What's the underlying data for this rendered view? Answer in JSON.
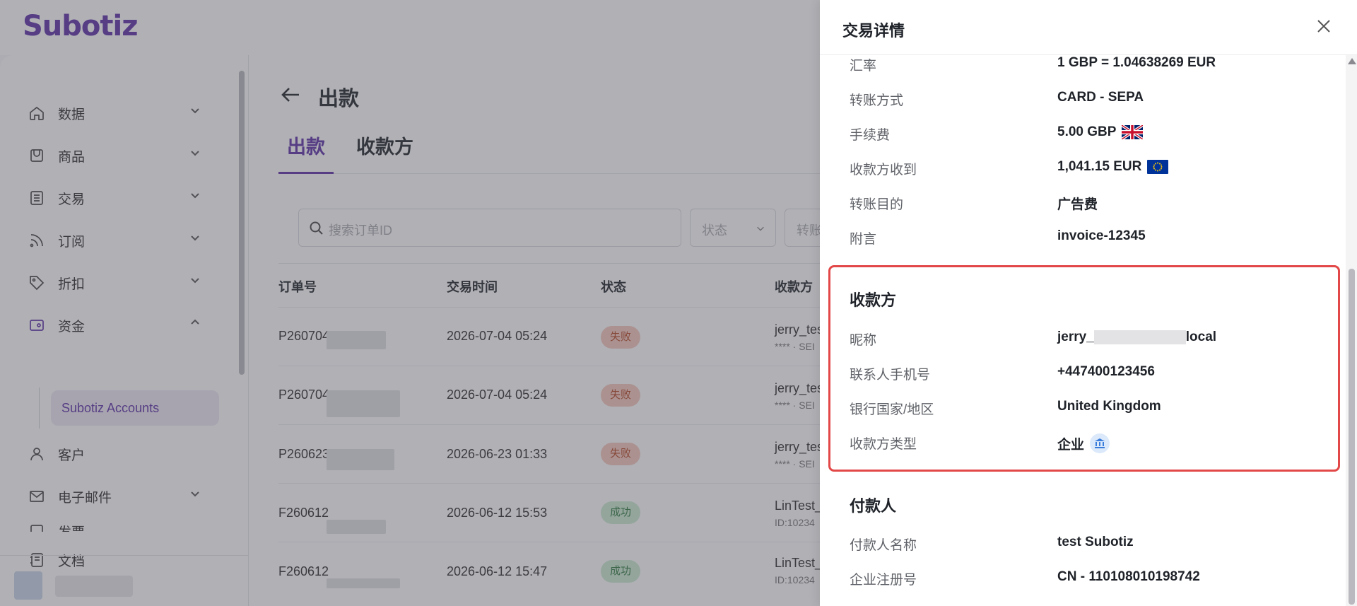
{
  "app": {
    "logo": "Subotiz"
  },
  "sidebar": {
    "items": [
      {
        "label": "数据",
        "icon": "home-icon"
      },
      {
        "label": "商品",
        "icon": "store-icon"
      },
      {
        "label": "交易",
        "icon": "list-icon"
      },
      {
        "label": "订阅",
        "icon": "rss-icon"
      },
      {
        "label": "折扣",
        "icon": "tag-icon"
      },
      {
        "label": "资金",
        "icon": "wallet-icon"
      },
      {
        "label": "客户",
        "icon": "user-icon"
      },
      {
        "label": "电子邮件",
        "icon": "mail-icon"
      },
      {
        "label": "发票",
        "icon": "invoice-icon"
      }
    ],
    "sub_item": "Subotiz Accounts",
    "docs_label": "文档"
  },
  "main": {
    "title": "出款",
    "tabs": [
      "出款",
      "收款方"
    ],
    "search_placeholder": "搜索订单ID",
    "status_placeholder": "状态",
    "third_filter": "转账",
    "columns": [
      "订单号",
      "交易时间",
      "状态",
      "收款方"
    ],
    "rows": [
      {
        "order": "P260704",
        "time": "2026-07-04 05:24",
        "status": "失败",
        "status_type": "fail",
        "payee": "jerry_tes",
        "payee_sub": "**** · SEI"
      },
      {
        "order": "P260704",
        "time": "2026-07-04 05:24",
        "status": "失败",
        "status_type": "fail",
        "payee": "jerry_tes",
        "payee_sub": "**** · SEI"
      },
      {
        "order": "P260623",
        "time": "2026-06-23 01:33",
        "status": "失败",
        "status_type": "fail",
        "payee": "jerry_tes",
        "payee_sub": "**** · SEI"
      },
      {
        "order": "F260612",
        "time": "2026-06-12 15:53",
        "status": "成功",
        "status_type": "ok",
        "payee": "LinTest_",
        "payee_sub": "ID:10234"
      },
      {
        "order": "F260612",
        "time": "2026-06-12 15:47",
        "status": "成功",
        "status_type": "ok",
        "payee": "LinTest_",
        "payee_sub": "ID:10234"
      }
    ]
  },
  "drawer": {
    "title": "交易详情",
    "details": [
      {
        "label": "汇率",
        "value": "1 GBP = 1.04638269 EUR"
      },
      {
        "label": "转账方式",
        "value": "CARD - SEPA"
      },
      {
        "label": "手续费",
        "value": "5.00 GBP",
        "flag": "uk-flag-icon"
      },
      {
        "label": "收款方收到",
        "value": "1,041.15 EUR",
        "flag": "eu-flag-icon"
      },
      {
        "label": "转账目的",
        "value": "广告费"
      },
      {
        "label": "附言",
        "value": "invoice-12345"
      }
    ],
    "payee": {
      "section_title": "收款方",
      "nickname_label": "昵称",
      "nickname_prefix": "jerry_",
      "nickname_suffix": "local",
      "phone_label": "联系人手机号",
      "phone_value": "+447400123456",
      "country_label": "银行国家/地区",
      "country_value": "United Kingdom",
      "type_label": "收款方类型",
      "type_value": "企业",
      "type_icon": "bank-icon"
    },
    "payer": {
      "section_title": "付款人",
      "name_label": "付款人名称",
      "name_value": "test Subotiz",
      "reg_label": "企业注册号",
      "reg_value": "CN - 110108010198742"
    },
    "highlight_color": "#e34848"
  },
  "colors": {
    "brand": "#5b2ea6",
    "fail_badge": "#f6c9bd",
    "success_badge": "#cdebd2"
  }
}
